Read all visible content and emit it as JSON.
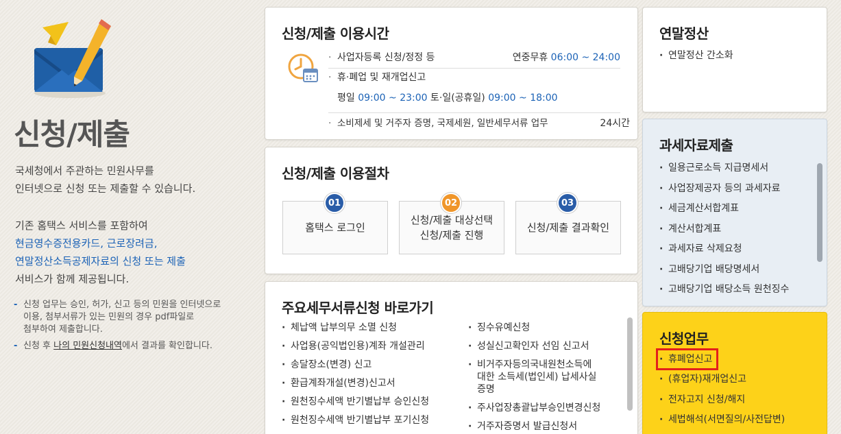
{
  "intro": {
    "title": "신청/제출",
    "desc1_line1": "국세청에서 주관하는 민원사무를",
    "desc1_line2": "인터넷으로 신청 또는 제출할 수 있습니다.",
    "desc2_line1": "기존 홈택스 서비스를 포함하여",
    "desc2_hl1": "현금영수증전용카드, 근로장려금,",
    "desc2_hl2": "연말정산소득공제자료의 신청 또는 제출",
    "desc2_line4": "서비스가 함께 제공됩니다.",
    "note1_a": "신청 업무는 승인, 허가, 신고 등의 민원을 인터넷으로",
    "note1_b": "이용, 첨부서류가 있는 민원의 경우 pdf파일로",
    "note1_c": "첨부하여 제출합니다.",
    "note2_pre": "신청 후 ",
    "note2_link": "나의 민원신청내역",
    "note2_post": "에서 결과를 확인합니다."
  },
  "hours": {
    "title": "신청/제출 이용시간",
    "row1_label": "사업자등록 신청/정정 등",
    "row1_prefix": "연중무휴 ",
    "row1_time": "06:00 ~ 24:00",
    "row2_label": "휴·폐업 및 재개업신고",
    "row2_sub_a": "평일 ",
    "row2_sub_t1": "09:00 ~ 23:00",
    "row2_sub_b": " 토·일(공휴일) ",
    "row2_sub_t2": "09:00 ~ 18:00",
    "row3_label": "소비제세 및 거주자 증명, 국제세원, 일반세무서류 업무",
    "row3_time": "24시간"
  },
  "procedure": {
    "title": "신청/제출 이용절차",
    "steps": [
      {
        "num": "01",
        "line1": "홈택스 로그인",
        "line2": "",
        "color": "#2a5da8"
      },
      {
        "num": "02",
        "line1": "신청/제출 대상선택",
        "line2": "신청/제출 진행",
        "color": "#f0962a"
      },
      {
        "num": "03",
        "line1": "신청/제출 결과확인",
        "line2": "",
        "color": "#2a5da8"
      }
    ]
  },
  "shortcuts": {
    "title": "주요세무서류신청 바로가기",
    "left": [
      "체납액 납부의무 소멸 신청",
      "사업용(공익법인용)계좌 개설관리",
      "송달장소(변경) 신고",
      "환급계좌개설(변경)신고서",
      "원천징수세액 반기별납부 승인신청",
      "원천징수세액 반기별납부 포기신청"
    ],
    "right": [
      "징수유예신청",
      "성실신고확인자 선임 신고서",
      "비거주자등의국내원천소득에",
      "대한 소득세(법인세) 납세사실",
      "증명",
      "주사업장총괄납부승인변경신청",
      "거주자증명서 발급신청서"
    ]
  },
  "yearend": {
    "title": "연말정산",
    "items": [
      "연말정산 간소화"
    ]
  },
  "taxdata": {
    "title": "과세자료제출",
    "items": [
      "일용근로소득 지급명세서",
      "사업장제공자 등의 과세자료",
      "세금계산서합계표",
      "계산서합계표",
      "과세자료 삭제요청",
      "고배당기업 배당명세서",
      "고배당기업 배당소득 원천징수"
    ]
  },
  "apply": {
    "title": "신청업무",
    "items": [
      "휴폐업신고",
      "(휴업자)재개업신고",
      "전자고지 신청/해지",
      "세법해석(서면질의/사전답변)"
    ]
  }
}
